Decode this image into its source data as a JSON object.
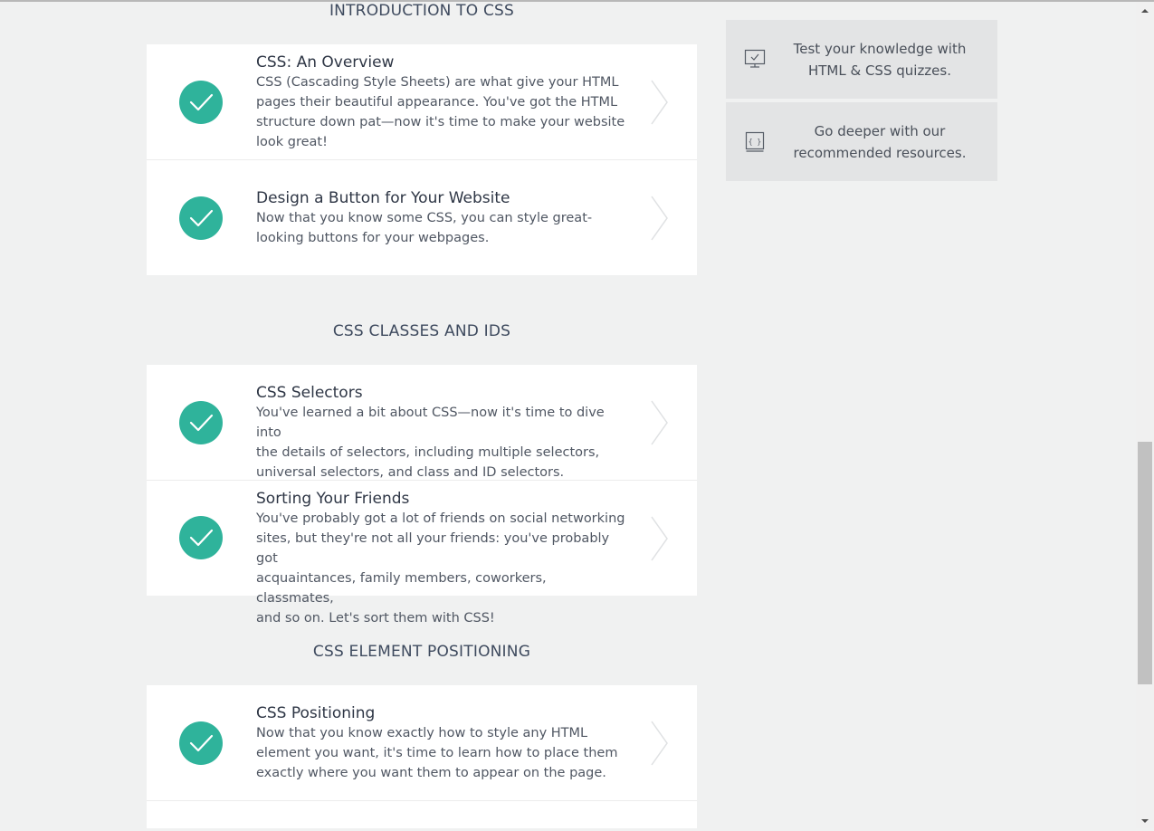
{
  "sections": [
    {
      "title": "INTRODUCTION TO CSS",
      "lessons": [
        {
          "title": "CSS: An Overview",
          "lines": [
            "CSS (Cascading Style Sheets) are what give your HTML",
            "pages their beautiful appearance. You've got the HTML",
            "structure down pat—now it's time to make your website",
            "look great!"
          ]
        },
        {
          "title": "Design a Button for Your Website",
          "lines": [
            "Now that you know some CSS, you can style great-",
            "looking buttons for your webpages."
          ]
        }
      ]
    },
    {
      "title": "CSS CLASSES AND IDS",
      "lessons": [
        {
          "title": "CSS Selectors",
          "lines": [
            "You've learned a bit about CSS—now it's time to dive into",
            "the details of selectors, including multiple selectors,",
            "universal selectors, and class and ID selectors."
          ]
        },
        {
          "title": "Sorting Your Friends",
          "lines": [
            "You've probably got a lot of friends on social networking",
            "sites, but they're not all your friends: you've probably got",
            "acquaintances, family members, coworkers, classmates,",
            "and so on. Let's sort them with CSS!"
          ]
        }
      ]
    },
    {
      "title": "CSS ELEMENT POSITIONING",
      "lessons": [
        {
          "title": "CSS Positioning",
          "lines": [
            "Now that you know exactly how to style any HTML",
            "element you want, it's time to learn how to place them",
            "exactly where you want them to appear on the page."
          ]
        }
      ]
    }
  ],
  "sidebar": {
    "quiz": {
      "icon": "monitor-check-icon",
      "lines": [
        "Test your knowledge with",
        "HTML & CSS quizzes."
      ]
    },
    "resources": {
      "icon": "book-code-icon",
      "lines": [
        "Go deeper with our",
        "recommended resources."
      ]
    }
  },
  "colors": {
    "accent": "#2fb39b",
    "background": "#f0f1f1",
    "card": "#ffffff",
    "sidebar_box": "#e3e4e5"
  }
}
